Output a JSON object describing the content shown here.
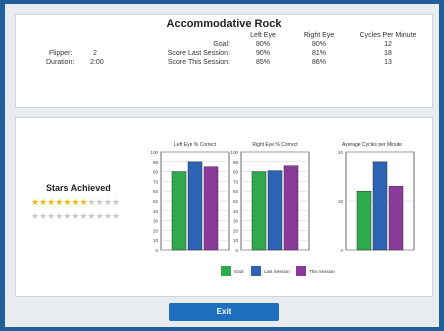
{
  "title": "Accommodative Rock",
  "columns": {
    "left_eye": "Left Eye",
    "right_eye": "Right Eye",
    "cpm": "Cycles Per Minute"
  },
  "rows": [
    {
      "label": "Goal:",
      "left": "80%",
      "right": "80%",
      "cpm": "12"
    },
    {
      "label": "Score Last Session:",
      "left": "90%",
      "right": "81%",
      "cpm": "18"
    },
    {
      "label": "Score This Session:",
      "left": "85%",
      "right": "86%",
      "cpm": "13"
    }
  ],
  "flipper": {
    "label": "Flipper:",
    "value": "2"
  },
  "duration": {
    "label": "Duration:",
    "value": "2:00"
  },
  "stars": {
    "title": "Stars Achieved",
    "achieved": 7,
    "total_row1": 11,
    "total_row2": 11
  },
  "legend": [
    {
      "name": "Goal",
      "color": "#2eaa4a"
    },
    {
      "name": "Last Session",
      "color": "#2c63b5"
    },
    {
      "name": "This Session",
      "color": "#8a3a9a"
    }
  ],
  "exit_label": "Exit",
  "chart_data": [
    {
      "type": "bar",
      "title": "Left Eye % Correct",
      "categories": [
        "Goal",
        "Last Session",
        "This Session"
      ],
      "values": [
        80,
        90,
        85
      ],
      "ylim": [
        0,
        100
      ],
      "yticks": [
        "0",
        "10",
        "20",
        "30",
        "40",
        "50",
        "60",
        "70",
        "80",
        "90",
        "100"
      ]
    },
    {
      "type": "bar",
      "title": "Right Eye % Correct",
      "categories": [
        "Goal",
        "Last Session",
        "This Session"
      ],
      "values": [
        80,
        81,
        86
      ],
      "ylim": [
        0,
        100
      ],
      "yticks": [
        "0",
        "10",
        "20",
        "30",
        "40",
        "50",
        "60",
        "70",
        "80",
        "90",
        "100"
      ]
    },
    {
      "type": "bar",
      "title": "Average Cycles per Minute",
      "categories": [
        "Goal",
        "Last Session",
        "This Session"
      ],
      "values": [
        12,
        18,
        13
      ],
      "ylim": [
        0,
        20
      ],
      "yticks": [
        "0",
        "10",
        "20"
      ]
    }
  ]
}
